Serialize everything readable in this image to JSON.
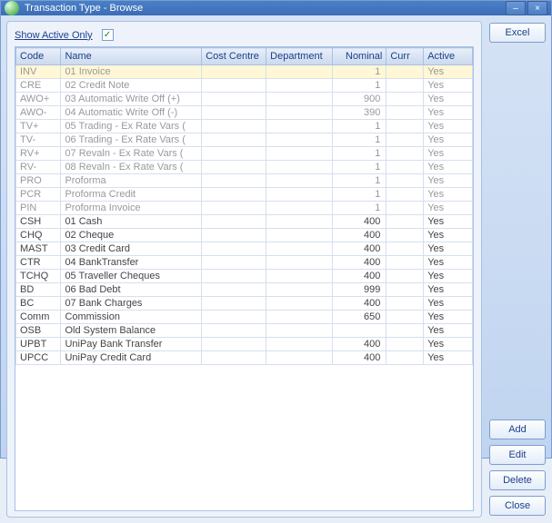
{
  "window": {
    "title": "Transaction Type - Browse"
  },
  "filter": {
    "label": "Show Active Only",
    "checked": true
  },
  "columns": [
    "Code",
    "Name",
    "Cost Centre",
    "Department",
    "Nominal",
    "Curr",
    "Active"
  ],
  "rows": [
    {
      "code": "INV",
      "name": "01 Invoice",
      "cost": "",
      "dept": "",
      "nominal": "1",
      "curr": "",
      "active": "Yes",
      "sel": true,
      "dim": true
    },
    {
      "code": "CRE",
      "name": "02 Credit Note",
      "cost": "",
      "dept": "",
      "nominal": "1",
      "curr": "",
      "active": "Yes",
      "dim": true
    },
    {
      "code": "AWO+",
      "name": "03 Automatic Write Off (+)",
      "cost": "",
      "dept": "",
      "nominal": "900",
      "curr": "",
      "active": "Yes",
      "dim": true
    },
    {
      "code": "AWO-",
      "name": "04 Automatic Write Off (-)",
      "cost": "",
      "dept": "",
      "nominal": "390",
      "curr": "",
      "active": "Yes",
      "dim": true
    },
    {
      "code": "TV+",
      "name": "05 Trading - Ex Rate Vars (",
      "cost": "",
      "dept": "",
      "nominal": "1",
      "curr": "",
      "active": "Yes",
      "dim": true
    },
    {
      "code": "TV-",
      "name": "06 Trading - Ex Rate Vars (",
      "cost": "",
      "dept": "",
      "nominal": "1",
      "curr": "",
      "active": "Yes",
      "dim": true
    },
    {
      "code": "RV+",
      "name": "07 Revaln - Ex Rate Vars (",
      "cost": "",
      "dept": "",
      "nominal": "1",
      "curr": "",
      "active": "Yes",
      "dim": true
    },
    {
      "code": "RV-",
      "name": "08 Revaln - Ex Rate Vars (",
      "cost": "",
      "dept": "",
      "nominal": "1",
      "curr": "",
      "active": "Yes",
      "dim": true
    },
    {
      "code": "PRO",
      "name": "Proforma",
      "cost": "",
      "dept": "",
      "nominal": "1",
      "curr": "",
      "active": "Yes",
      "dim": true
    },
    {
      "code": "PCR",
      "name": "Proforma Credit",
      "cost": "",
      "dept": "",
      "nominal": "1",
      "curr": "",
      "active": "Yes",
      "dim": true
    },
    {
      "code": "PIN",
      "name": "Proforma Invoice",
      "cost": "",
      "dept": "",
      "nominal": "1",
      "curr": "",
      "active": "Yes",
      "dim": true
    },
    {
      "code": "CSH",
      "name": "01 Cash",
      "cost": "",
      "dept": "",
      "nominal": "400",
      "curr": "",
      "active": "Yes"
    },
    {
      "code": "CHQ",
      "name": "02 Cheque",
      "cost": "",
      "dept": "",
      "nominal": "400",
      "curr": "",
      "active": "Yes"
    },
    {
      "code": "MAST",
      "name": "03 Credit Card",
      "cost": "",
      "dept": "",
      "nominal": "400",
      "curr": "",
      "active": "Yes"
    },
    {
      "code": "CTR",
      "name": "04 BankTransfer",
      "cost": "",
      "dept": "",
      "nominal": "400",
      "curr": "",
      "active": "Yes"
    },
    {
      "code": "TCHQ",
      "name": "05 Traveller Cheques",
      "cost": "",
      "dept": "",
      "nominal": "400",
      "curr": "",
      "active": "Yes"
    },
    {
      "code": "BD",
      "name": "06 Bad Debt",
      "cost": "",
      "dept": "",
      "nominal": "999",
      "curr": "",
      "active": "Yes"
    },
    {
      "code": "BC",
      "name": "07 Bank Charges",
      "cost": "",
      "dept": "",
      "nominal": "400",
      "curr": "",
      "active": "Yes"
    },
    {
      "code": "Comm",
      "name": "Commission",
      "cost": "",
      "dept": "",
      "nominal": "650",
      "curr": "",
      "active": "Yes"
    },
    {
      "code": "OSB",
      "name": "Old System Balance",
      "cost": "",
      "dept": "",
      "nominal": "",
      "curr": "",
      "active": "Yes"
    },
    {
      "code": "UPBT",
      "name": "UniPay Bank Transfer",
      "cost": "",
      "dept": "",
      "nominal": "400",
      "curr": "",
      "active": "Yes"
    },
    {
      "code": "UPCC",
      "name": "UniPay Credit Card",
      "cost": "",
      "dept": "",
      "nominal": "400",
      "curr": "",
      "active": "Yes"
    }
  ],
  "buttons": {
    "excel": "Excel",
    "add": "Add",
    "edit": "Edit",
    "delete": "Delete",
    "close": "Close"
  }
}
